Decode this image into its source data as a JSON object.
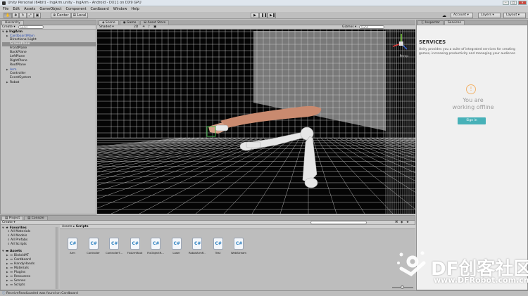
{
  "window": {
    "title": "Unity Personal (64bit) - IngArm.unity - IngArm - Android - DX11 on DX9 GPU"
  },
  "menu": [
    "File",
    "Edit",
    "Assets",
    "GameObject",
    "Component",
    "Cardboard",
    "Window",
    "Help"
  ],
  "toolbar": {
    "pivot_label": "Center",
    "space_label": "Local",
    "account_label": "Account",
    "layers_label": "Layers",
    "layout_label": "Layout"
  },
  "hierarchy": {
    "tab_label": "Hierarchy",
    "create_label": "Create",
    "search_placeholder": "Q▾All",
    "scene_name": "IngArm",
    "items": [
      {
        "label": "CardboardMain",
        "expandable": true,
        "blue": true,
        "selected": false
      },
      {
        "label": "Directional Light",
        "expandable": false,
        "blue": false,
        "selected": false
      },
      {
        "label": "ScreenPlane",
        "expandable": false,
        "blue": false,
        "selected": true
      },
      {
        "label": "FrontPlane",
        "expandable": false,
        "blue": false,
        "selected": false
      },
      {
        "label": "BackPlane",
        "expandable": false,
        "blue": false,
        "selected": false
      },
      {
        "label": "LeftPlane",
        "expandable": false,
        "blue": false,
        "selected": false
      },
      {
        "label": "RightPlane",
        "expandable": false,
        "blue": false,
        "selected": false
      },
      {
        "label": "RoofPlane",
        "expandable": false,
        "blue": false,
        "selected": false
      },
      {
        "label": "Arm",
        "expandable": true,
        "blue": true,
        "selected": false
      },
      {
        "label": "Controller",
        "expandable": false,
        "blue": false,
        "selected": false
      },
      {
        "label": "EventSystem",
        "expandable": false,
        "blue": false,
        "selected": false
      },
      {
        "label": "Robot",
        "expandable": true,
        "blue": false,
        "selected": false
      }
    ]
  },
  "scene_view": {
    "tabs": [
      "Scene",
      "Game",
      "Asset Store"
    ],
    "shading_label": "Shaded",
    "mode_2d_label": "2D",
    "gizmos_label": "Gizmos",
    "search_placeholder": "Q▾All",
    "persp_label": "Persp"
  },
  "inspector": {
    "tabs": [
      "Inspector",
      "Services"
    ],
    "services_title": "SERVICES",
    "services_desc": "Unity provides you a suite of integrated services for creating games, increasing productivity and managing your audience",
    "offline_line1": "You are",
    "offline_line2": "working offline",
    "signin_label": "Sign in"
  },
  "project": {
    "tabs": [
      "Project",
      "Console"
    ],
    "create_label": "Create",
    "favorites_label": "Favorites",
    "favorites": [
      "All Materials",
      "All Models",
      "All Prefabs",
      "All Scripts"
    ],
    "assets_label": "Assets",
    "folders": [
      "BioloidAT",
      "Cardboard",
      "HandyHands",
      "Materials",
      "Plugins",
      "Resources",
      "Scenes",
      "Scripts"
    ],
    "breadcrumb": [
      "Assets",
      "Scripts"
    ],
    "scripts": [
      "Arm",
      "Controller",
      "ControllerT...",
      "FixArmRoot",
      "FixObjectR...",
      "Laser",
      "RobotArmR...",
      "Test",
      "WebStream"
    ]
  },
  "status": {
    "message": "ReceiveReadLoaded was found on Cardboard"
  },
  "watermark": {
    "main": "DF创客社区",
    "sub": "www.DFRobot.com.cn"
  },
  "colors": {
    "selection": "#8e8e8e",
    "signin": "#47b1b8",
    "csharp": "#2a7fbf",
    "grid": "#e8e8e8"
  }
}
